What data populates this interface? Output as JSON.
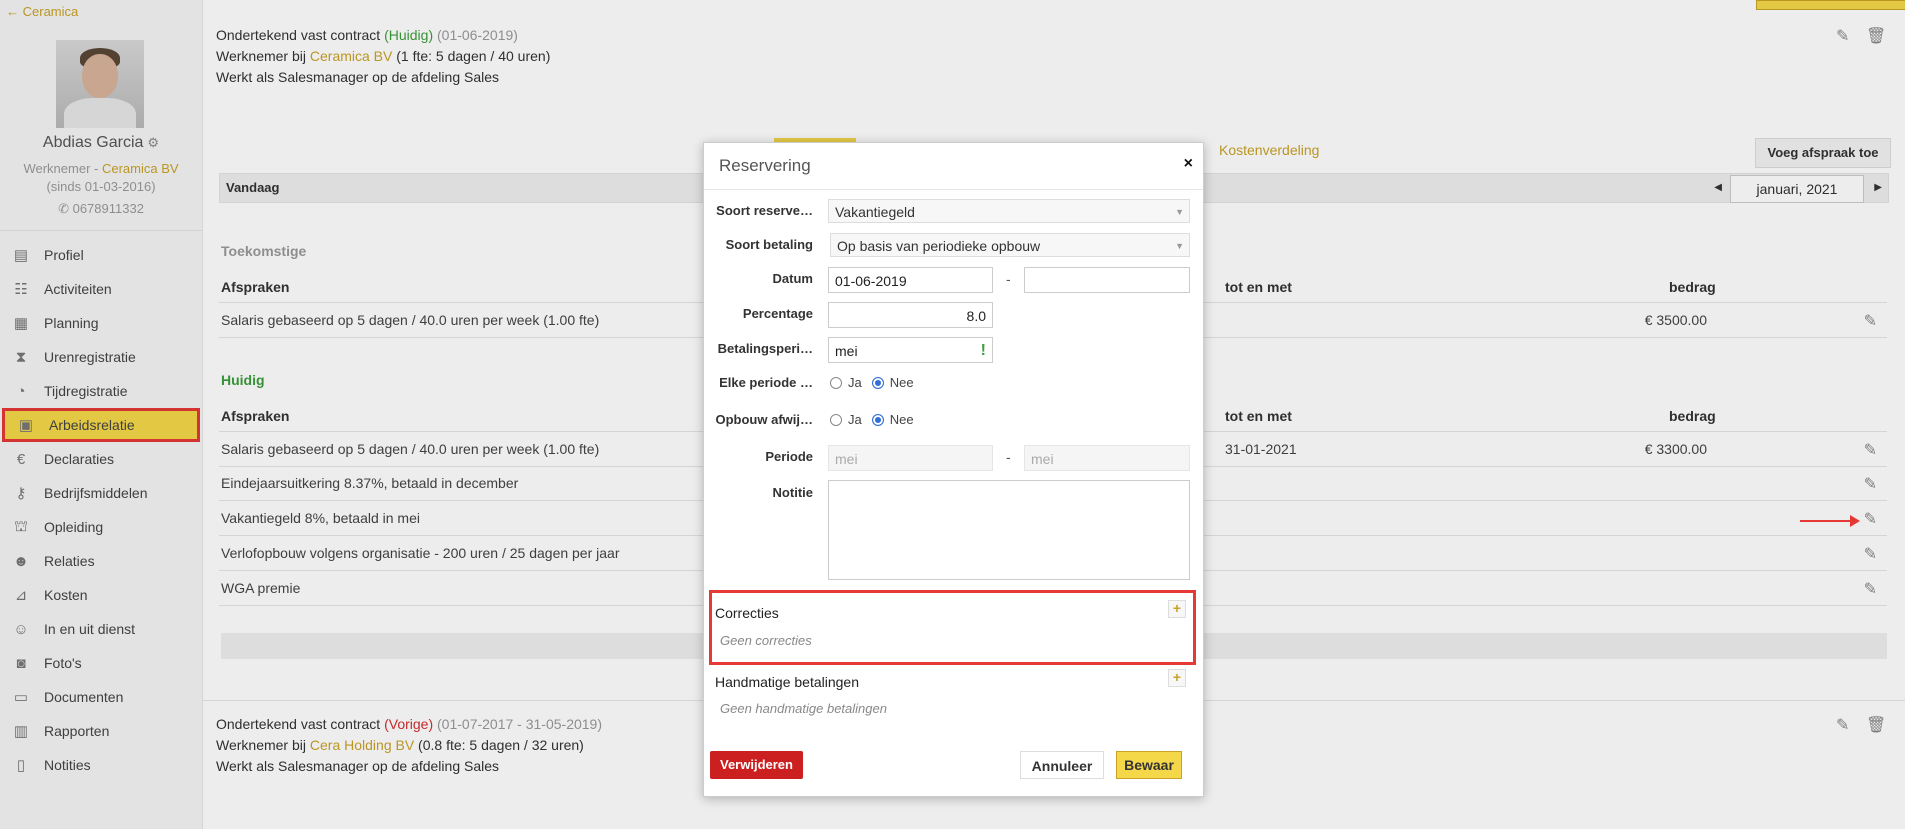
{
  "sidebar": {
    "back_label": "Ceramica",
    "user": {
      "name": "Abdias Garcia",
      "role_prefix": "Werknemer - ",
      "company": "Ceramica BV",
      "since": "(sinds 01-03-2016)",
      "phone": "0678911332"
    },
    "items": [
      {
        "label": "Profiel",
        "icon": "id-card-icon"
      },
      {
        "label": "Activiteiten",
        "icon": "table-icon"
      },
      {
        "label": "Planning",
        "icon": "calendar-icon"
      },
      {
        "label": "Urenregistratie",
        "icon": "hourglass-icon"
      },
      {
        "label": "Tijdregistratie",
        "icon": "stopwatch-icon"
      },
      {
        "label": "Arbeidsrelatie",
        "icon": "document-icon"
      },
      {
        "label": "Declaraties",
        "icon": "euro-icon"
      },
      {
        "label": "Bedrijfsmiddelen",
        "icon": "key-icon"
      },
      {
        "label": "Opleiding",
        "icon": "graduation-cap-icon"
      },
      {
        "label": "Relaties",
        "icon": "users-icon"
      },
      {
        "label": "Kosten",
        "icon": "chart-icon"
      },
      {
        "label": "In en uit dienst",
        "icon": "user-check-icon"
      },
      {
        "label": "Foto's",
        "icon": "camera-icon"
      },
      {
        "label": "Documenten",
        "icon": "folder-icon"
      },
      {
        "label": "Rapporten",
        "icon": "report-icon"
      },
      {
        "label": "Notities",
        "icon": "clipboard-icon"
      }
    ]
  },
  "current_contract": {
    "title": "Ondertekend vast contract",
    "status": "(Huidig)",
    "date": "(01-06-2019)",
    "employer_prefix": "Werknemer bij ",
    "employer": "Ceramica BV",
    "fte": " (1 fte: 5 dagen / 40 uren)",
    "role": "Werkt als Salesmanager op de afdeling Sales"
  },
  "tabs": {
    "kosten": "Kostenverdeling"
  },
  "add_button": "Voeg afspraak toe",
  "calendar": {
    "today": "Vandaag",
    "month": "januari, 2021"
  },
  "future": {
    "label": "Toekomstige",
    "headers": {
      "afspraken": "Afspraken",
      "tot": "tot en met",
      "bedrag": "bedrag"
    },
    "rows": [
      {
        "text": "Salaris gebaseerd op 5 dagen / 40.0 uren per week (1.00 fte)",
        "end": "",
        "amount": "€ 3500.00"
      }
    ]
  },
  "current": {
    "label": "Huidig",
    "headers": {
      "afspraken": "Afspraken",
      "tot": "tot en met",
      "bedrag": "bedrag"
    },
    "rows": [
      {
        "text": "Salaris gebaseerd op 5 dagen / 40.0 uren per week (1.00 fte)",
        "end": "31-01-2021",
        "amount": "€ 3300.00"
      },
      {
        "text": "Eindejaarsuitkering 8.37%, betaald in december",
        "end": "",
        "amount": ""
      },
      {
        "text": "Vakantiegeld 8%, betaald in mei",
        "end": "",
        "amount": ""
      },
      {
        "text": "Verlofopbouw volgens organisatie - 200 uren / 25 dagen per jaar",
        "end": "",
        "amount": ""
      },
      {
        "text": "WGA premie",
        "end": "",
        "amount": ""
      }
    ]
  },
  "previous_contract": {
    "title": "Ondertekend vast contract",
    "status": "(Vorige)",
    "date": "(01-07-2017 - 31-05-2019)",
    "employer_prefix": "Werknemer bij ",
    "employer": "Cera Holding BV",
    "fte": " (0.8 fte: 5 dagen / 32 uren)",
    "role": "Werkt als Salesmanager op de afdeling Sales"
  },
  "modal": {
    "title": "Reservering",
    "close": "×",
    "fields": {
      "soort_reservering": {
        "label": "Soort reserve…",
        "value": "Vakantiegeld"
      },
      "soort_betaling": {
        "label": "Soort betaling",
        "value": "Op basis van periodieke opbouw"
      },
      "datum": {
        "label": "Datum",
        "from": "01-06-2019",
        "to": ""
      },
      "percentage": {
        "label": "Percentage",
        "value": "8.0"
      },
      "betalingsperiode": {
        "label": "Betalingsperi…",
        "value": "mei"
      },
      "elke_periode": {
        "label": "Elke periode …",
        "ja": "Ja",
        "nee": "Nee",
        "selected": "Nee"
      },
      "opbouw": {
        "label": "Opbouw afwij…",
        "ja": "Ja",
        "nee": "Nee",
        "selected": "Nee"
      },
      "periode": {
        "label": "Periode",
        "from_placeholder": "mei",
        "to_placeholder": "mei"
      },
      "notitie": {
        "label": "Notitie",
        "value": ""
      }
    },
    "correcties": {
      "title": "Correcties",
      "empty": "Geen correcties"
    },
    "handmatig": {
      "title": "Handmatige betalingen",
      "empty": "Geen handmatige betalingen"
    },
    "buttons": {
      "delete": "Verwijderen",
      "cancel": "Annuleer",
      "save": "Bewaar"
    }
  },
  "colors": {
    "accent": "#f5d84a",
    "link": "#c9a227",
    "danger": "#cc1f1f",
    "highlight": "#e53935"
  }
}
